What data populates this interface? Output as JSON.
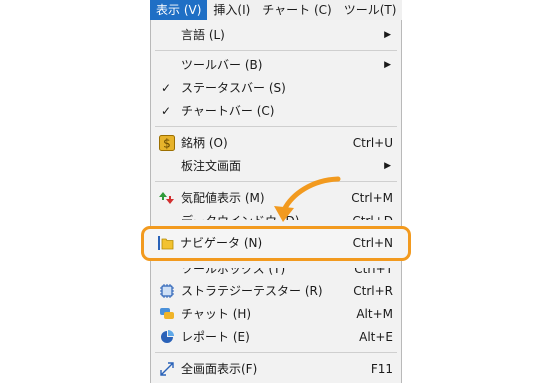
{
  "menubar": {
    "items": [
      {
        "label": "表示 (V)"
      },
      {
        "label": "挿入(I)"
      },
      {
        "label": "チャート (C)"
      },
      {
        "label": "ツール(T)"
      }
    ]
  },
  "menu": {
    "language": {
      "label": "言語 (L)"
    },
    "toolbar": {
      "label": "ツールバー (B)"
    },
    "statusbar": {
      "label": "ステータスバー (S)"
    },
    "chartbar": {
      "label": "チャートバー (C)"
    },
    "symbols": {
      "label": "銘柄 (O)",
      "shortcut": "Ctrl+U"
    },
    "order_book": {
      "label": "板注文画面"
    },
    "market_watch": {
      "label": "気配値表示 (M)",
      "shortcut": "Ctrl+M"
    },
    "data_window": {
      "label": "データウインドウ (D)",
      "shortcut": "Ctrl+D"
    },
    "navigator": {
      "label": "ナビゲータ (N)",
      "shortcut": "Ctrl+N"
    },
    "toolbox": {
      "label": "ツールボックス (T)",
      "shortcut": "Ctrl+T"
    },
    "strategy_tester": {
      "label": "ストラテジーテスター (R)",
      "shortcut": "Ctrl+R"
    },
    "chat": {
      "label": "チャット (H)",
      "shortcut": "Alt+M"
    },
    "report": {
      "label": "レポート (E)",
      "shortcut": "Alt+E"
    },
    "fullscreen": {
      "label": "全画面表示(F)",
      "shortcut": "F11"
    }
  },
  "colors": {
    "highlight_border": "#f29a1f",
    "menubar_active": "#1f6fc5",
    "arrow": "#f29a1f"
  },
  "glyphs": {
    "check": "✓",
    "submenu": "▶"
  }
}
